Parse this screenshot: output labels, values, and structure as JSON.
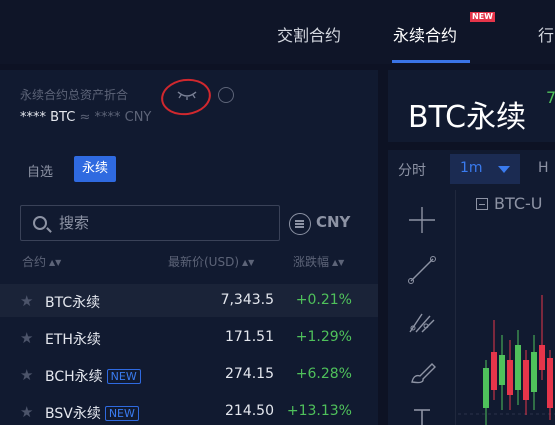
{
  "topnav": {
    "items": [
      {
        "label": "交割合约"
      },
      {
        "label": "永续合约",
        "badge": "NEW"
      },
      {
        "label": "行"
      }
    ]
  },
  "asset": {
    "title": "永续合约总资产折合",
    "value_btc": "**** BTC",
    "approx": "≈ **** CNY"
  },
  "tabs": {
    "favorites": "自选",
    "perpetual": "永续"
  },
  "search": {
    "placeholder": "搜索"
  },
  "currency": {
    "label": "CNY"
  },
  "columns": {
    "contract": "合约",
    "price": "最新价(USD)",
    "change": "涨跌幅"
  },
  "rows": [
    {
      "symbol": "BTC永续",
      "badge": "",
      "price": "7,343.5",
      "change": "+0.21%"
    },
    {
      "symbol": "ETH永续",
      "badge": "",
      "price": "171.51",
      "change": "+1.29%"
    },
    {
      "symbol": "BCH永续",
      "badge": "NEW",
      "price": "274.15",
      "change": "+6.28%"
    },
    {
      "symbol": "BSV永续",
      "badge": "NEW",
      "price": "214.50",
      "change": "+13.13%"
    }
  ],
  "instrument": {
    "title": "BTC永续",
    "price_partial": "7"
  },
  "chart": {
    "tf_label": "分时",
    "tf_active": "1m",
    "tf_next": "H",
    "symbol": "BTC-U"
  },
  "colors": {
    "accent": "#2f6ae0",
    "up": "#4fc15b",
    "down": "#e5354a",
    "annotation": "#d0282e"
  }
}
